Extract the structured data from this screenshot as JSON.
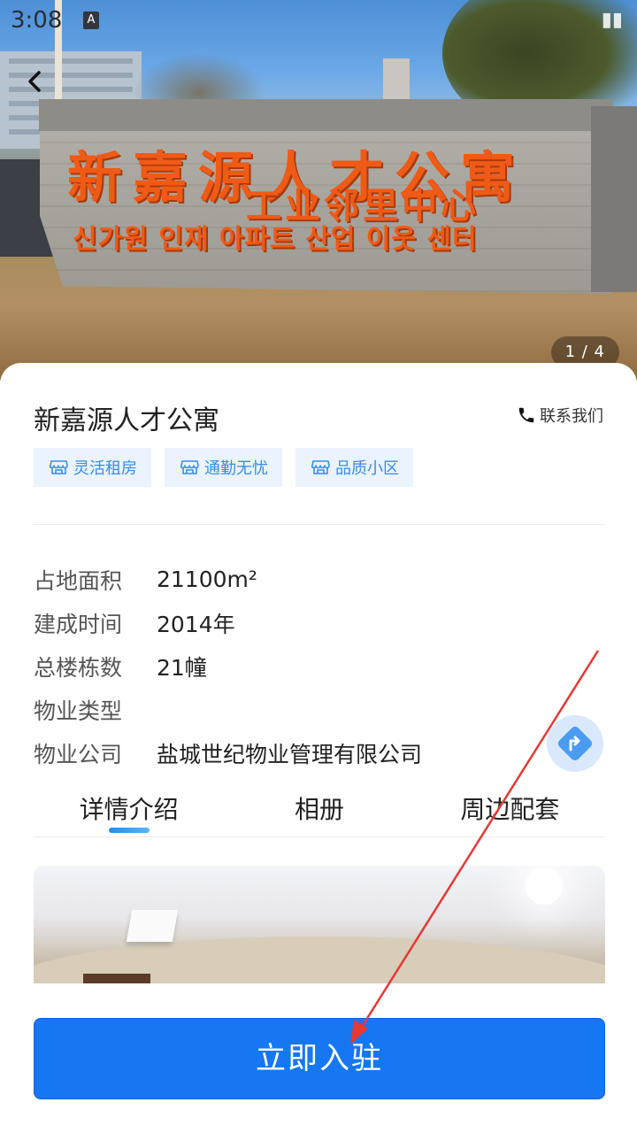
{
  "status_bar": {
    "time": "3:08",
    "notification_icon_label": "A"
  },
  "gallery": {
    "counter": "1 / 4",
    "sign": {
      "line1": "新嘉源人才公寓",
      "line2": "工业邻里中心",
      "line3": "신가원 인재 아파트 산업 이웃 센터"
    }
  },
  "property": {
    "title": "新嘉源人才公寓",
    "contact_label": "联系我们",
    "tags": [
      "灵活租房",
      "通勤无忧",
      "品质小区"
    ]
  },
  "info": [
    {
      "label": "占地面积",
      "value": "21100m²"
    },
    {
      "label": "建成时间",
      "value": "2014年"
    },
    {
      "label": "总楼栋数",
      "value": "21幢"
    },
    {
      "label": "物业类型",
      "value": ""
    },
    {
      "label": "物业公司",
      "value": "盐城世纪物业管理有限公司"
    }
  ],
  "tabs": [
    {
      "label": "详情介绍",
      "active": true
    },
    {
      "label": "相册",
      "active": false
    },
    {
      "label": "周边配套",
      "active": false
    }
  ],
  "cta": {
    "label": "立即入驻"
  },
  "colors": {
    "accent": "#1677f3",
    "tag_bg": "#eaf3fe",
    "tag_text": "#3a8be8",
    "annotation_arrow": "#e53935"
  },
  "icons": {
    "back": "chevron-left-icon",
    "contact": "phone-icon",
    "tag": "store-icon",
    "fab": "navigation-icon"
  }
}
